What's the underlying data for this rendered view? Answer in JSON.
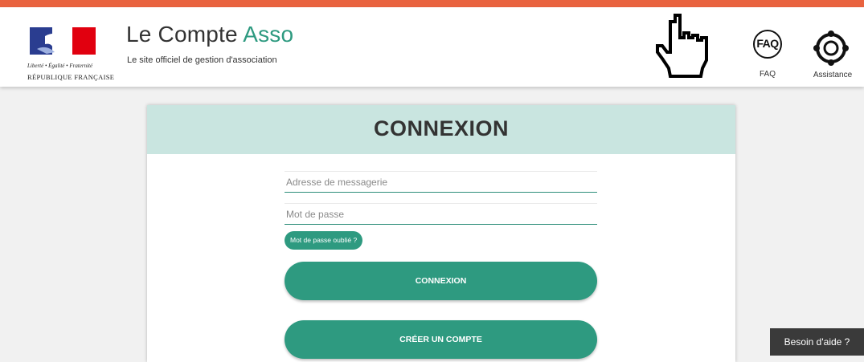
{
  "header": {
    "brand_part1": "Le Compte ",
    "brand_part2": "Asso",
    "subtitle": "Le site officiel de gestion d'association",
    "rf_motto": "Liberté • Égalité • Fraternité",
    "rf_name": "RÉPUBLIQUE FRANÇAISE",
    "faq_icon_text": "FAQ",
    "faq_label": "FAQ",
    "assistance_label": "Assistance"
  },
  "login": {
    "title": "CONNEXION",
    "email_placeholder": "Adresse de messagerie",
    "password_placeholder": "Mot de passe",
    "forgot_label": "Mot de passe oublié ?",
    "login_button": "CONNEXION",
    "create_button": "CRÉER UN COMPTE"
  },
  "help_label": "Besoin d'aide ?",
  "colors": {
    "accent": "#2e9a80",
    "card_header": "#c9e5e0",
    "top_bar": "#e9633f",
    "help_bg": "#3a3a3a"
  },
  "icons": [
    "marianne-logo",
    "hand-pointer-cursor",
    "faq-icon",
    "lifebuoy-icon"
  ]
}
